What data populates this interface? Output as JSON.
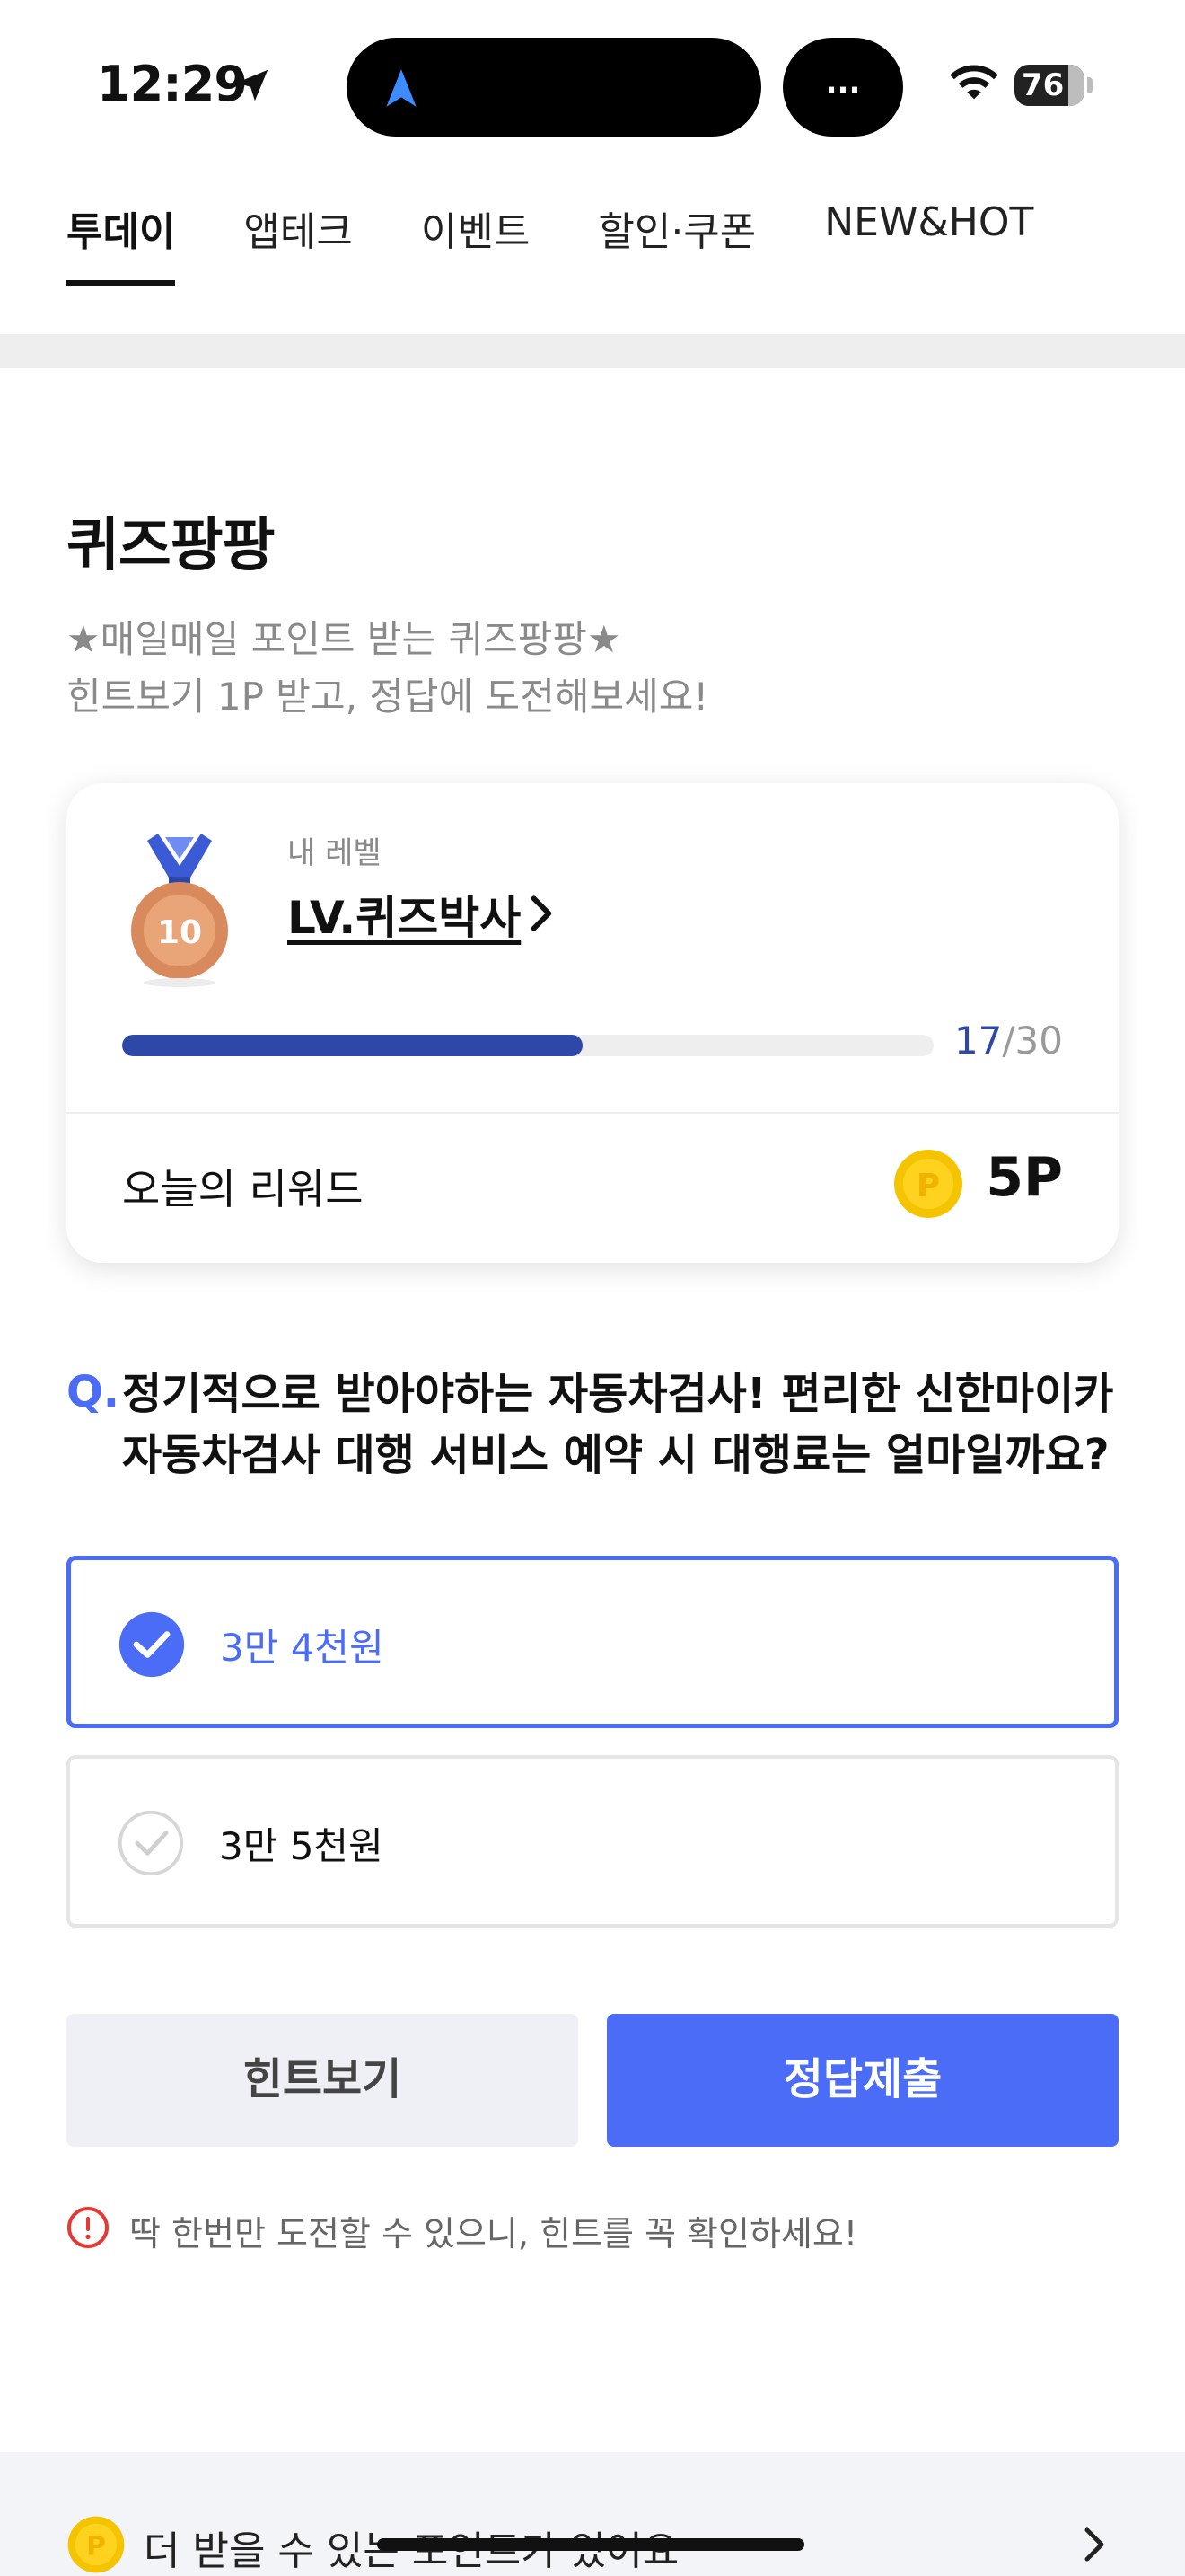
{
  "status_bar": {
    "time": "12:29",
    "island_dots": "...",
    "battery": "76",
    "icons": [
      "location-arrow-icon",
      "navigation-icon",
      "wifi-icon",
      "battery-icon"
    ]
  },
  "tabs": [
    {
      "label": "투데이",
      "active": true
    },
    {
      "label": "앱테크",
      "active": false
    },
    {
      "label": "이벤트",
      "active": false
    },
    {
      "label": "할인·쿠폰",
      "active": false
    },
    {
      "label": "NEW&HOT",
      "active": false
    }
  ],
  "quiz": {
    "title": "퀴즈팡팡",
    "desc_line1": "★매일매일 포인트 받는 퀴즈팡팡★",
    "desc_line2": "힌트보기 1P 받고, 정답에 도전해보세요!"
  },
  "level_card": {
    "medal_number": "10",
    "caption": "내 레벨",
    "level_name": "LV.퀴즈박사",
    "progress_current": "17",
    "progress_total": "/30",
    "progress_fraction": 0.567,
    "reward_label": "오늘의 리워드",
    "coin_symbol": "P",
    "reward_value": "5P"
  },
  "question": {
    "prefix": "Q.",
    "line1": "정기적으로 받아야하는 자동차검사! 편리한 신한마이카",
    "line2": "자동차검사 대행 서비스 예약 시 대행료는 얼마일까요?"
  },
  "options": [
    {
      "label": "3만 4천원",
      "selected": true
    },
    {
      "label": "3만 5천원",
      "selected": false
    }
  ],
  "buttons": {
    "hint": "힌트보기",
    "submit": "정답제출"
  },
  "warning": "딱 한번만 도전할 수 있으니, 힌트를 꼭 확인하세요!",
  "more_points": {
    "coin_symbol": "P",
    "label": "더 받을 수 있는 포인트가 있어요"
  },
  "colors": {
    "accent": "#4a6cf7",
    "progress": "#2d48a6",
    "coin": "#f5c400",
    "warning": "#e53935"
  }
}
